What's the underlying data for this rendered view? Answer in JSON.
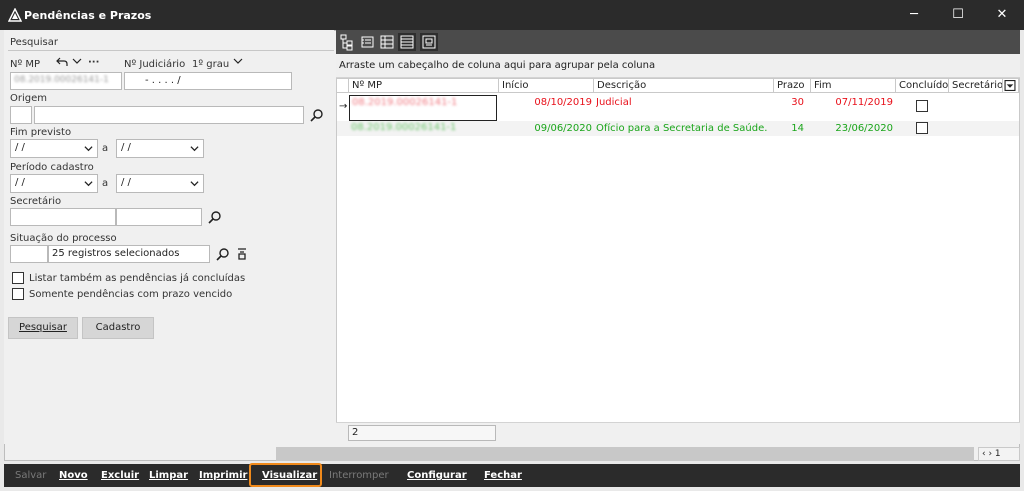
{
  "window": {
    "title": "Pendências e Prazos"
  },
  "left": {
    "search_title": "Pesquisar",
    "nmp_label": "Nº MP",
    "nmp_value": "08.2019.00026141-1",
    "judicial_label": "Nº Judiciário",
    "grau_label": "1º grau",
    "judicial_value": "- .   . . .   /",
    "origem_label": "Origem",
    "fim_label": "Fim previsto",
    "fim_from": "/ /",
    "fim_to": "/ /",
    "a_label": "a",
    "periodo_label": "Período cadastro",
    "periodo_from": "/ /",
    "periodo_to": "/ /",
    "secretario_label": "Secretário",
    "situacao_label": "Situação do processo",
    "situacao_value": "25 registros selecionados",
    "chk1": "Listar também as pendências já concluídas",
    "chk2": "Somente pendências com prazo vencido",
    "btn_pesquisar": "Pesquisar",
    "btn_cadastro": "Cadastro"
  },
  "grid": {
    "group_hint": "Arraste um cabeçalho de coluna aqui para agrupar pela coluna",
    "columns": [
      "Nº MP",
      "Início",
      "Descrição",
      "Prazo",
      "Fim",
      "Concluído",
      "Secretário"
    ],
    "rows": [
      {
        "nmp": "08.2019.00026141-1",
        "inicio": "08/10/2019",
        "descricao": "Judicial",
        "prazo": "30",
        "fim": "07/11/2019",
        "color": "#e8101a"
      },
      {
        "nmp": "08.2019.00026141-1",
        "inicio": "09/06/2020",
        "descricao": "Ofício para a Secretaria de Saúde.",
        "prazo": "14",
        "fim": "23/06/2020",
        "color": "#1aa51a"
      }
    ],
    "count": "2",
    "page": "1"
  },
  "bottom": {
    "salvar": "Salvar",
    "novo": "Novo",
    "excluir": "Excluir",
    "limpar": "Limpar",
    "imprimir": "Imprimir",
    "visualizar": "Visualizar",
    "interromper": "Interromper",
    "configurar": "Configurar",
    "fechar": "Fechar"
  },
  "colors": {
    "accent": "#f08a1c",
    "titlebar": "#2b2b2b"
  }
}
